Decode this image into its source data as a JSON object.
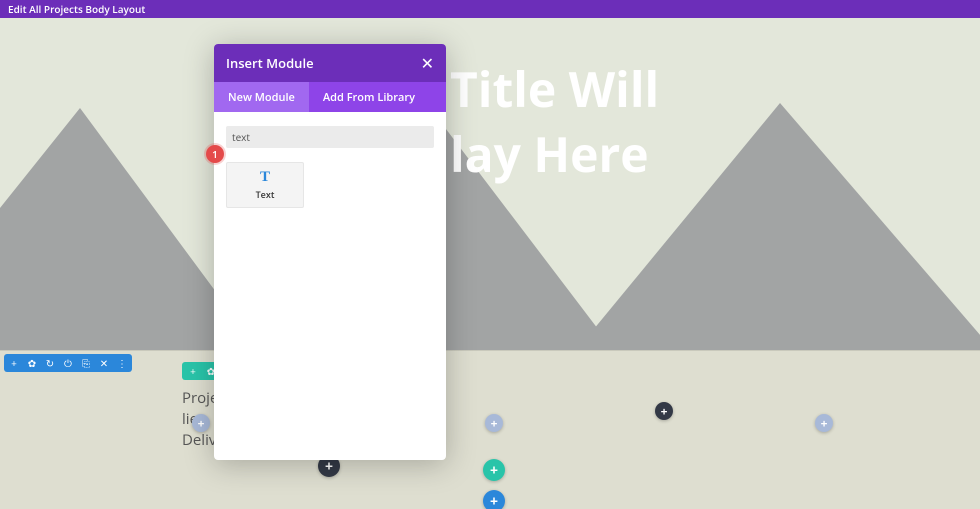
{
  "topbar": {
    "title": "Edit All Projects Body Layout"
  },
  "hero": {
    "line1": "Title Will",
    "line2": "lay Here"
  },
  "project_meta": {
    "l1": "Proje",
    "l2": "lien",
    "l3": "Deliv"
  },
  "section_toolbar": {
    "icons": [
      "+",
      "✿",
      "↻",
      "⏻",
      "⎘",
      "✕",
      "⋮"
    ]
  },
  "row_toolbar": {
    "icons": [
      "+",
      "✿"
    ]
  },
  "modal": {
    "title": "Insert Module",
    "close_glyph": "✕",
    "tabs": {
      "new": "New Module",
      "lib": "Add From Library"
    },
    "search": {
      "value": "text",
      "placeholder": ""
    },
    "module": {
      "glyph": "T",
      "label": "Text"
    }
  },
  "annotations": {
    "one": "1"
  },
  "colors": {
    "purple": "#6c2eb9",
    "purple_tab": "#8e44e8",
    "purple_tab_active": "#a168f0",
    "blue": "#2b87da",
    "teal": "#29c4a9",
    "badge_red": "#e44a4a"
  },
  "glyphs": {
    "plus": "+"
  }
}
